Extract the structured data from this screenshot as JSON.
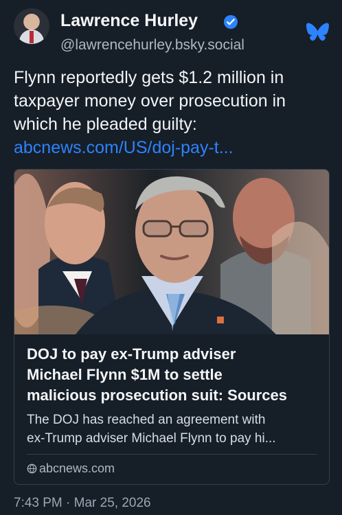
{
  "author": {
    "name": "Lawrence Hurley",
    "handle": "@lawrencehurley.bsky.social"
  },
  "post": {
    "lines": [
      "Flynn reportedly gets $1.2 million in",
      "taxpayer money over prosecution in",
      "which he pleaded guilty:"
    ],
    "link": "abcnews.com/US/doj-pay-t..."
  },
  "embed": {
    "title_lines": [
      "DOJ to pay ex-Trump adviser",
      "Michael Flynn $1M to settle",
      "malicious prosecution suit: Sources"
    ],
    "description_lines": [
      "The DOJ has reached an agreement with",
      "ex-Trump adviser Michael Flynn to pay hi..."
    ],
    "source": "abcnews.com"
  },
  "meta": {
    "timestamp": "7:43 PM · Mar 25, 2026"
  },
  "colors": {
    "background": "#161e27",
    "link": "#2d83ff",
    "verified_badge": "#2d83ff",
    "muted_text": "#aeb8c4"
  },
  "icons": [
    "verified-badge-icon",
    "bluesky-butterfly-icon",
    "globe-icon"
  ]
}
